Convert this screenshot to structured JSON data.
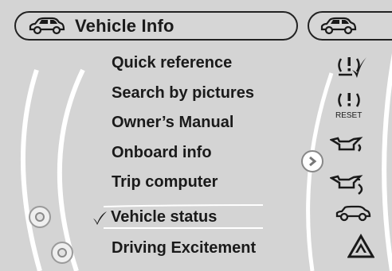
{
  "header": {
    "title": "Vehicle Info",
    "title_icon": "car-icon",
    "next_tab_icon": "car-icon"
  },
  "menu": {
    "items": [
      {
        "label": "Quick reference"
      },
      {
        "label": "Search by pictures"
      },
      {
        "label": "Owner’s Manual"
      },
      {
        "label": "Onboard info"
      },
      {
        "label": "Trip computer"
      },
      {
        "label": "Vehicle status",
        "selected": true,
        "marker": "checkmark-icon"
      },
      {
        "label": "Driving Excitement"
      }
    ]
  },
  "side_icons": [
    {
      "name": "warning-check-icon"
    },
    {
      "name": "warning-reset-icon",
      "label": "RESET"
    },
    {
      "name": "oil-can-icon"
    },
    {
      "name": "oil-level-icon"
    },
    {
      "name": "car-side-icon"
    },
    {
      "name": "hazard-triangle-icon"
    }
  ],
  "colors": {
    "background": "#d4d4d4",
    "arc": "#ffffff",
    "text": "#1a1a1a"
  }
}
